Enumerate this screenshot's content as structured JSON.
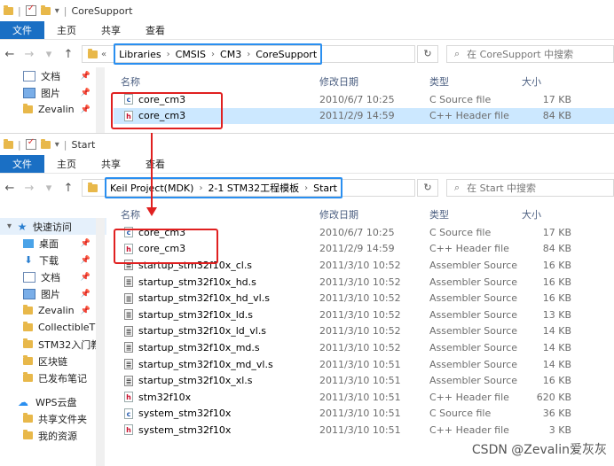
{
  "colors": {
    "accent": "#1a6fc4",
    "highlight": "#2a8ff0",
    "annotation": "#e02020",
    "selected_row": "#cce8ff"
  },
  "ribbon": {
    "file": "文件",
    "home": "主页",
    "share": "共享",
    "view": "查看"
  },
  "window1": {
    "title": "CoreSupport",
    "crumb_prefix": "«",
    "crumbs": [
      "Libraries",
      "CMSIS",
      "CM3",
      "CoreSupport"
    ],
    "search_placeholder": "在 CoreSupport 中搜索",
    "nav": [
      {
        "label": "文档",
        "icon": "document-icon"
      },
      {
        "label": "图片",
        "icon": "picture-icon"
      },
      {
        "label": "Zevalin",
        "icon": "folder-icon"
      }
    ],
    "columns": {
      "name": "名称",
      "date": "修改日期",
      "type": "类型",
      "size": "大小"
    },
    "files": [
      {
        "name": "core_cm3",
        "date": "2010/6/7 10:25",
        "type": "C Source file",
        "size": "17 KB",
        "kind": "c"
      },
      {
        "name": "core_cm3",
        "date": "2011/2/9 14:59",
        "type": "C++ Header file",
        "size": "84 KB",
        "kind": "h"
      }
    ]
  },
  "window2": {
    "title": "Start",
    "crumbs": [
      "Keil Project(MDK)",
      "2-1 STM32工程模板",
      "Start"
    ],
    "search_placeholder": "在 Start 中搜索",
    "nav": [
      {
        "label": "快速访问",
        "icon": "quick-access-star-icon"
      },
      {
        "label": "桌面",
        "icon": "desktop-icon"
      },
      {
        "label": "下载",
        "icon": "download-icon"
      },
      {
        "label": "文档",
        "icon": "document-icon"
      },
      {
        "label": "图片",
        "icon": "picture-icon"
      },
      {
        "label": "Zevalin",
        "icon": "folder-icon"
      },
      {
        "label": "CollectibleT",
        "icon": "folder-icon"
      },
      {
        "label": "STM32入门教",
        "icon": "folder-icon"
      },
      {
        "label": "区块链",
        "icon": "folder-icon"
      },
      {
        "label": "已发布笔记",
        "icon": "folder-icon"
      },
      {
        "label": "WPS云盘",
        "icon": "cloud-icon"
      },
      {
        "label": "共享文件夹",
        "icon": "folder-icon"
      },
      {
        "label": "我的资源",
        "icon": "folder-icon"
      }
    ],
    "columns": {
      "name": "名称",
      "date": "修改日期",
      "type": "类型",
      "size": "大小"
    },
    "files": [
      {
        "name": "core_cm3",
        "date": "2010/6/7 10:25",
        "type": "C Source file",
        "size": "17 KB",
        "kind": "c"
      },
      {
        "name": "core_cm3",
        "date": "2011/2/9 14:59",
        "type": "C++ Header file",
        "size": "84 KB",
        "kind": "h"
      },
      {
        "name": "startup_stm32f10x_cl.s",
        "date": "2011/3/10 10:52",
        "type": "Assembler Source",
        "size": "16 KB",
        "kind": "s"
      },
      {
        "name": "startup_stm32f10x_hd.s",
        "date": "2011/3/10 10:52",
        "type": "Assembler Source",
        "size": "16 KB",
        "kind": "s"
      },
      {
        "name": "startup_stm32f10x_hd_vl.s",
        "date": "2011/3/10 10:52",
        "type": "Assembler Source",
        "size": "16 KB",
        "kind": "s"
      },
      {
        "name": "startup_stm32f10x_ld.s",
        "date": "2011/3/10 10:52",
        "type": "Assembler Source",
        "size": "13 KB",
        "kind": "s"
      },
      {
        "name": "startup_stm32f10x_ld_vl.s",
        "date": "2011/3/10 10:52",
        "type": "Assembler Source",
        "size": "14 KB",
        "kind": "s"
      },
      {
        "name": "startup_stm32f10x_md.s",
        "date": "2011/3/10 10:52",
        "type": "Assembler Source",
        "size": "14 KB",
        "kind": "s"
      },
      {
        "name": "startup_stm32f10x_md_vl.s",
        "date": "2011/3/10 10:51",
        "type": "Assembler Source",
        "size": "14 KB",
        "kind": "s"
      },
      {
        "name": "startup_stm32f10x_xl.s",
        "date": "2011/3/10 10:51",
        "type": "Assembler Source",
        "size": "16 KB",
        "kind": "s"
      },
      {
        "name": "stm32f10x",
        "date": "2011/3/10 10:51",
        "type": "C++ Header file",
        "size": "620 KB",
        "kind": "h"
      },
      {
        "name": "system_stm32f10x",
        "date": "2011/3/10 10:51",
        "type": "C Source file",
        "size": "36 KB",
        "kind": "c"
      },
      {
        "name": "system_stm32f10x",
        "date": "2011/3/10 10:51",
        "type": "C++ Header file",
        "size": "3 KB",
        "kind": "h"
      }
    ]
  },
  "watermark": "CSDN @Zevalin爱灰灰"
}
